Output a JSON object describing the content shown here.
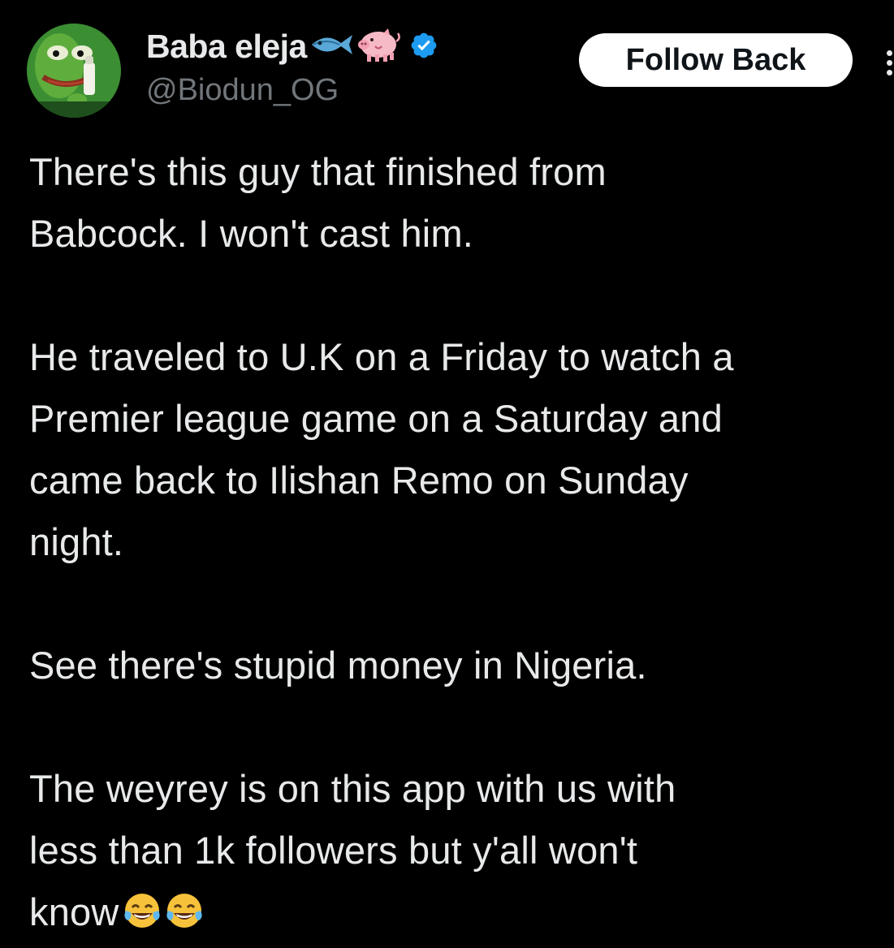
{
  "tweet": {
    "author": {
      "display_name": "Baba eleja",
      "handle": "@Biodun_OG",
      "verified": true,
      "name_emojis": [
        "fish-emoji",
        "pig-emoji"
      ],
      "avatar": "pepe-frog-avatar"
    },
    "follow_button_label": "Follow Back",
    "more_icon": "more-options-icon",
    "paragraphs": [
      "There's this guy that finished from\nBabcock. I won't cast him.",
      "He traveled to U.K on a Friday to watch a\nPremier league game on a Saturday and\ncame back to Ilishan Remo on Sunday\nnight.",
      "See there's stupid money in Nigeria.",
      "The weyrey is on this app with us with\nless than 1k followers but y'all won't\nknow"
    ],
    "trailing_emojis": [
      "laughing-tears-emoji",
      "laughing-tears-emoji"
    ]
  },
  "colors": {
    "background": "#000000",
    "text_primary": "#e7e9ea",
    "text_secondary": "#71767b",
    "verified_badge": "#1d9bf0",
    "button_bg": "#ffffff",
    "button_text": "#0f1419"
  }
}
